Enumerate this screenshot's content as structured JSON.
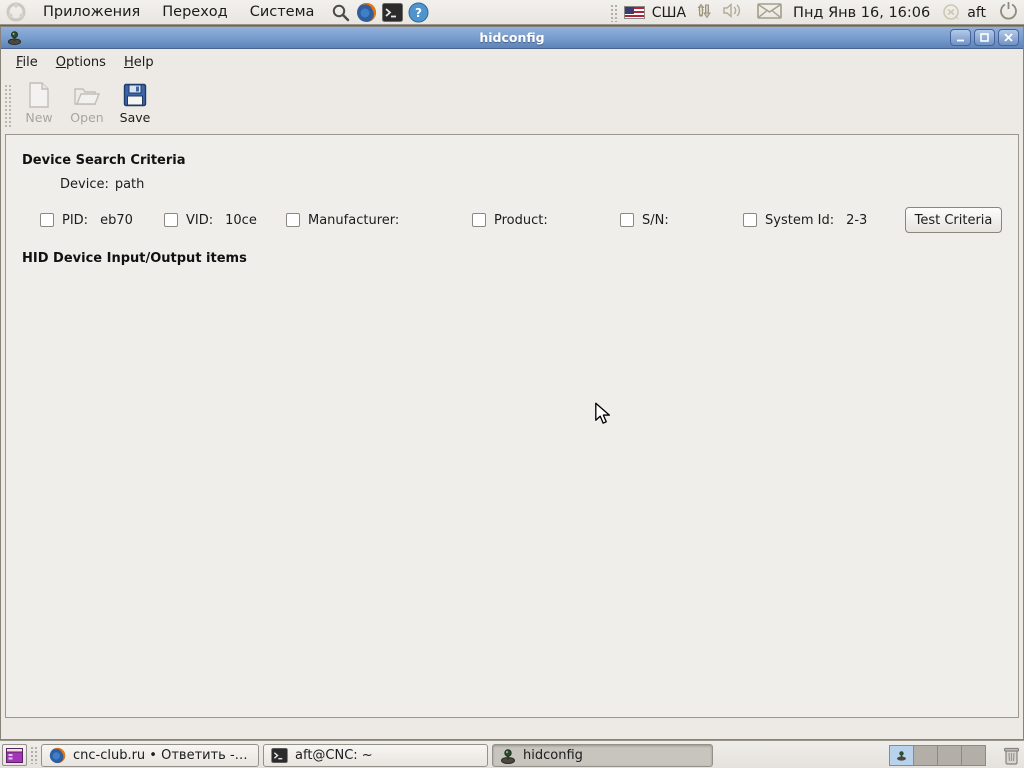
{
  "top_panel": {
    "menus": [
      {
        "label": "Приложения"
      },
      {
        "label": "Переход"
      },
      {
        "label": "Система"
      }
    ],
    "tray": {
      "keyboard_layout": "США",
      "clock": "Пнд Янв 16, 16:06",
      "user": "aft"
    }
  },
  "window": {
    "title": "hidconfig",
    "menu": {
      "items": [
        {
          "label": "File"
        },
        {
          "label": "Options"
        },
        {
          "label": "Help"
        }
      ]
    },
    "toolbar": {
      "buttons": [
        {
          "label": "New",
          "enabled": false
        },
        {
          "label": "Open",
          "enabled": false
        },
        {
          "label": "Save",
          "enabled": true
        }
      ]
    },
    "criteria": {
      "heading": "Device Search Criteria",
      "device_label": "Device:",
      "device_value": "path",
      "checkboxes": [
        {
          "label": "PID:",
          "value": "eb70",
          "checked": false
        },
        {
          "label": "VID:",
          "value": "10ce",
          "checked": false
        },
        {
          "label": "Manufacturer:",
          "value": "",
          "checked": false
        },
        {
          "label": "Product:",
          "value": "",
          "checked": false
        },
        {
          "label": "S/N:",
          "value": "",
          "checked": false
        },
        {
          "label": "System Id:",
          "value": "2-3",
          "checked": false
        }
      ],
      "test_button_label": "Test Criteria"
    },
    "io_section": {
      "heading": "HID Device Input/Output items"
    }
  },
  "taskbar": {
    "tasks": [
      {
        "label": "cnc-club.ru • Ответить - ...",
        "icon": "firefox-icon",
        "active": false
      },
      {
        "label": "aft@CNC: ~",
        "icon": "terminal-icon",
        "active": false
      },
      {
        "label": "hidconfig",
        "icon": "joystick-icon",
        "active": true
      }
    ],
    "workspace_count": 4
  },
  "colors": {
    "titlebar_blue": "#7ba0d0",
    "panel_bg": "#edeae5",
    "content_bg": "#f0eeea",
    "active_workspace": "#b9d2ec"
  }
}
